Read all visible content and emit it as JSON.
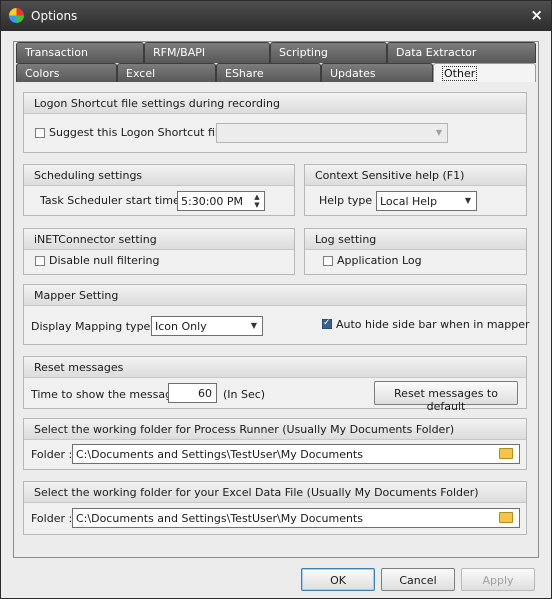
{
  "window": {
    "title": "Options",
    "close_glyph": "×"
  },
  "tabs": {
    "row1": [
      "Transaction",
      "RFM/BAPI",
      "Scripting",
      "Data Extractor"
    ],
    "row2": [
      "Colors",
      "Excel",
      "EShare",
      "Updates",
      "Other"
    ],
    "active": "Other"
  },
  "logon": {
    "header": "Logon Shortcut file settings during recording",
    "suggest_label": "Suggest this Logon Shortcut file :",
    "suggest_checked": false,
    "file_value": ""
  },
  "scheduling": {
    "header": "Scheduling settings",
    "label": "Task Scheduler start time :",
    "value": "5:30:00 PM"
  },
  "help": {
    "header": "Context Sensitive help (F1)",
    "label": "Help type :",
    "value": "Local Help"
  },
  "inet": {
    "header": "iNETConnector setting",
    "disable_null_label": "Disable null filtering",
    "checked": false
  },
  "log": {
    "header": "Log setting",
    "app_log_label": "Application Log",
    "checked": false
  },
  "mapper": {
    "header": "Mapper Setting",
    "display_label": "Display Mapping type :",
    "display_value": "Icon Only",
    "auto_hide_label": "Auto hide side bar when in mapper",
    "auto_hide_checked": true
  },
  "reset": {
    "header": "Reset messages",
    "time_label": "Time to show the message",
    "time_value": "60",
    "unit": "(In Sec)",
    "button": "Reset messages to default"
  },
  "process_folder": {
    "header": "Select the working folder for Process Runner (Usually My Documents Folder)",
    "label": "Folder :",
    "value": "C:\\Documents and Settings\\TestUser\\My Documents"
  },
  "excel_folder": {
    "header": "Select the working folder for your Excel Data File (Usually My Documents Folder)",
    "label": "Folder :",
    "value": "C:\\Documents and Settings\\TestUser\\My Documents"
  },
  "buttons": {
    "ok": "OK",
    "cancel": "Cancel",
    "apply": "Apply"
  }
}
